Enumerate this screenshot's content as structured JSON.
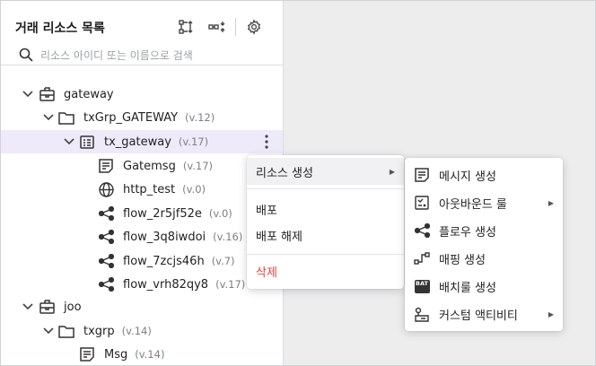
{
  "panel": {
    "title": "거래 리소스 목록",
    "search": {
      "placeholder": "리소스 아이디 또는 이름으로 검색",
      "value": ""
    },
    "icons": [
      "tree-expand-icon",
      "collapse-all-icon",
      "settings-gear-icon"
    ]
  },
  "tree": [
    {
      "label": "gateway",
      "version": "",
      "icon": "folder-root-icon"
    },
    {
      "label": "txGrp_GATEWAY",
      "version": "(v.12)",
      "icon": "folder-icon"
    },
    {
      "label": "tx_gateway",
      "version": "(v.17)",
      "icon": "transaction-icon"
    },
    {
      "label": "Gatemsg",
      "version": "(v.17)",
      "icon": "message-icon"
    },
    {
      "label": "http_test",
      "version": "(v.0)",
      "icon": "globe-icon"
    },
    {
      "label": "flow_2r5jf52e",
      "version": "(v.0)",
      "icon": "flow-icon"
    },
    {
      "label": "flow_3q8iwdoi",
      "version": "(v.16)",
      "icon": "flow-icon"
    },
    {
      "label": "flow_7zcjs46h",
      "version": "(v.7)",
      "icon": "flow-icon"
    },
    {
      "label": "flow_vrh82qy8",
      "version": "(v.17)",
      "icon": "flow-icon"
    },
    {
      "label": "joo",
      "version": "",
      "icon": "folder-root-icon"
    },
    {
      "label": "txgrp",
      "version": "(v.14)",
      "icon": "folder-icon"
    },
    {
      "label": "Msg",
      "version": "(v.14)",
      "icon": "message-icon"
    }
  ],
  "context_menu": {
    "create_resource": "리소스 생성",
    "deploy": "배포",
    "undeploy": "배포 해제",
    "delete": "삭제"
  },
  "submenu": {
    "items": [
      {
        "label": "메시지 생성",
        "icon": "message-icon"
      },
      {
        "label": "아웃바운드 룰",
        "icon": "outbound-rule-icon"
      },
      {
        "label": "플로우 생성",
        "icon": "flow-icon"
      },
      {
        "label": "매핑 생성",
        "icon": "mapping-icon"
      },
      {
        "label": "배치룰 생성",
        "icon": "batch-icon"
      },
      {
        "label": "커스텀 액티비티",
        "icon": "custom-activity-icon"
      }
    ],
    "bat_badge": "BAT"
  }
}
